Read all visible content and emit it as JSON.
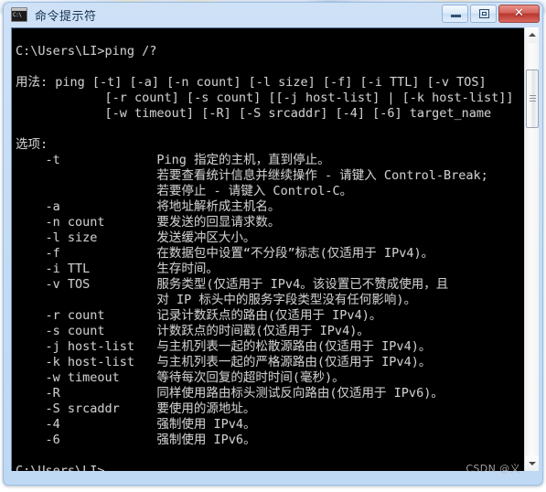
{
  "window": {
    "title": "命令提示符",
    "icon": "console-icon",
    "icon_glyph": "C:\\",
    "controls": {
      "minimize_label": "最小化",
      "maximize_label": "还原",
      "close_label": "关闭",
      "close_glyph": "✕"
    }
  },
  "console": {
    "prompt_top": "C:\\Users\\LI>",
    "command": "ping /?",
    "prompt_bottom": "C:\\Users\\LI>",
    "usage_label": "用法:",
    "options_label": "选项:",
    "usage_lines": [
      "用法: ping [-t] [-a] [-n count] [-l size] [-f] [-i TTL] [-v TOS]",
      "            [-r count] [-s count] [[-j host-list] | [-k host-list]]",
      "            [-w timeout] [-R] [-S srcaddr] [-4] [-6] target_name"
    ],
    "options": [
      {
        "flag": "-t",
        "description": [
          "Ping 指定的主机，直到停止。",
          "若要查看统计信息并继续操作 - 请键入 Control-Break;",
          "若要停止 - 请键入 Control-C。"
        ]
      },
      {
        "flag": "-a",
        "description": [
          "将地址解析成主机名。"
        ]
      },
      {
        "flag": "-n count",
        "description": [
          "要发送的回显请求数。"
        ]
      },
      {
        "flag": "-l size",
        "description": [
          "发送缓冲区大小。"
        ]
      },
      {
        "flag": "-f",
        "description": [
          "在数据包中设置“不分段”标志(仅适用于 IPv4)。"
        ]
      },
      {
        "flag": "-i TTL",
        "description": [
          "生存时间。"
        ]
      },
      {
        "flag": "-v TOS",
        "description": [
          "服务类型(仅适用于 IPv4。该设置已不赞成使用，且",
          "对 IP 标头中的服务字段类型没有任何影响)。"
        ]
      },
      {
        "flag": "-r count",
        "description": [
          "记录计数跃点的路由(仅适用于 IPv4)。"
        ]
      },
      {
        "flag": "-s count",
        "description": [
          "计数跃点的时间戳(仅适用于 IPv4)。"
        ]
      },
      {
        "flag": "-j host-list",
        "description": [
          "与主机列表一起的松散源路由(仅适用于 IPv4)。"
        ]
      },
      {
        "flag": "-k host-list",
        "description": [
          "与主机列表一起的严格源路由(仅适用于 IPv4)。"
        ]
      },
      {
        "flag": "-w timeout",
        "description": [
          "等待每次回复的超时时间(毫秒)。"
        ]
      },
      {
        "flag": "-R",
        "description": [
          "同样使用路由标头测试反向路由(仅适用于 IPv6)。"
        ]
      },
      {
        "flag": "-S srcaddr",
        "description": [
          "要使用的源地址。"
        ]
      },
      {
        "flag": "-4",
        "description": [
          "强制使用 IPv4。"
        ]
      },
      {
        "flag": "-6",
        "description": [
          "强制使用 IPv6。"
        ]
      }
    ],
    "full_text": "C:\\Users\\LI>ping /?\n\n用法: ping [-t] [-a] [-n count] [-l size] [-f] [-i TTL] [-v TOS]\n            [-r count] [-s count] [[-j host-list] | [-k host-list]]\n            [-w timeout] [-R] [-S srcaddr] [-4] [-6] target_name\n\n选项:\n    -t             Ping 指定的主机，直到停止。\n                   若要查看统计信息并继续操作 - 请键入 Control-Break;\n                   若要停止 - 请键入 Control-C。\n    -a             将地址解析成主机名。\n    -n count       要发送的回显请求数。\n    -l size        发送缓冲区大小。\n    -f             在数据包中设置“不分段”标志(仅适用于 IPv4)。\n    -i TTL         生存时间。\n    -v TOS         服务类型(仅适用于 IPv4。该设置已不赞成使用，且\n                   对 IP 标头中的服务字段类型没有任何影响)。\n    -r count       记录计数跃点的路由(仅适用于 IPv4)。\n    -s count       计数跃点的时间戳(仅适用于 IPv4)。\n    -j host-list   与主机列表一起的松散源路由(仅适用于 IPv4)。\n    -k host-list   与主机列表一起的严格源路由(仅适用于 IPv4)。\n    -w timeout     等待每次回复的超时时间(毫秒)。\n    -R             同样使用路由标头测试反向路由(仅适用于 IPv6)。\n    -S srcaddr     要使用的源地址。\n    -4             强制使用 IPv4。\n    -6             强制使用 IPv6。\n\nC:\\Users\\LI>"
  },
  "scrollbar": {
    "up_arrow": "▲",
    "down_arrow": "▼"
  },
  "watermark": {
    "text": "CSDN @义"
  },
  "colors": {
    "window_frame": "#c3dbf4",
    "console_bg": "#000000",
    "console_fg": "#cccccc",
    "close_button": "#b8352c",
    "title_text": "#15314f"
  }
}
